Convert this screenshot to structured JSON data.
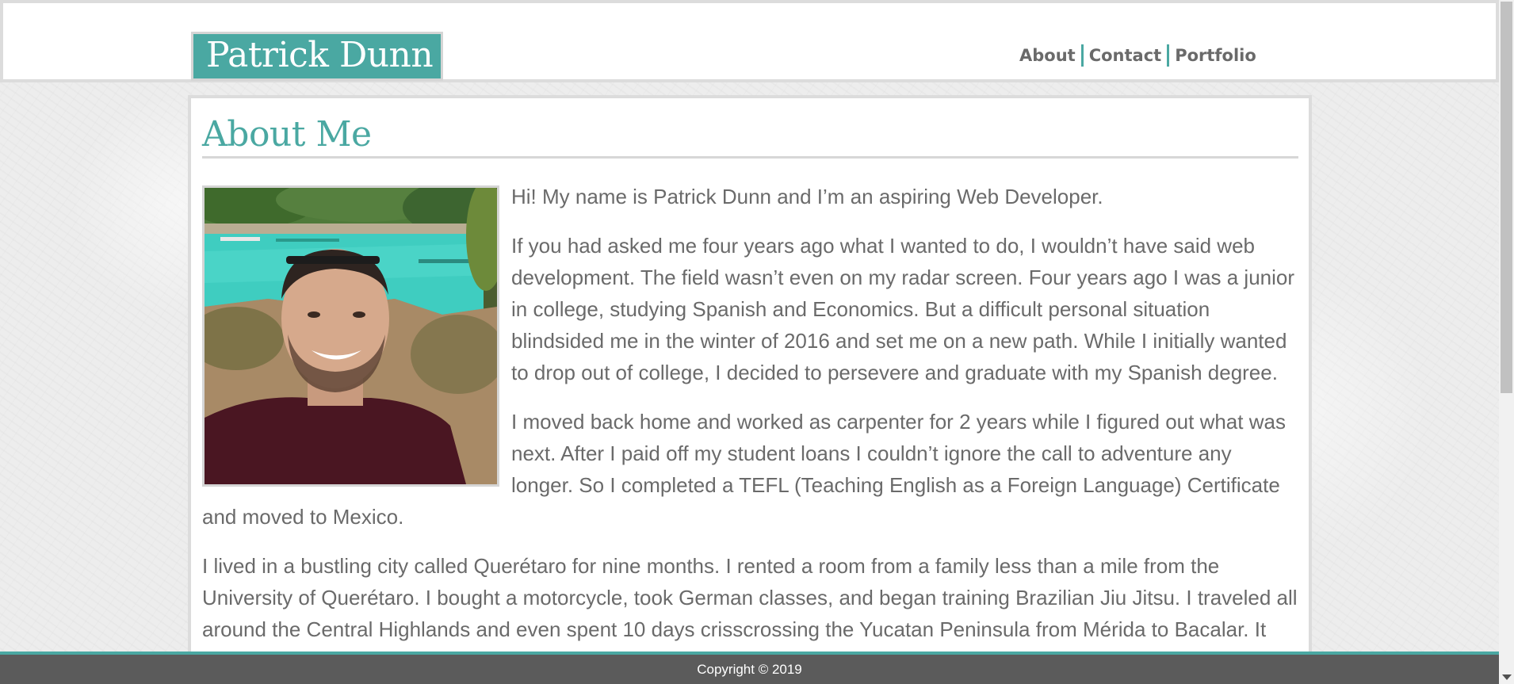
{
  "header": {
    "logo_text": "Patrick Dunn",
    "nav": [
      {
        "label": "About"
      },
      {
        "label": "Contact"
      },
      {
        "label": "Portfolio"
      }
    ]
  },
  "main": {
    "title": "About Me",
    "photo": {
      "alt": "Patrick Dunn selfie in front of turquoise river"
    },
    "paragraphs": [
      "Hi! My name is Patrick Dunn and I’m an aspiring Web Developer.",
      "If you had asked me four years ago what I wanted to do, I wouldn’t have said web development. The field wasn’t even on my radar screen. Four years ago I was a junior in college, studying Spanish and Economics. But a difficult personal situation blindsided me in the winter of 2016 and set me on a new path. While I initially wanted to drop out of college, I decided to persevere and graduate with my Spanish degree.",
      "I moved back home and worked as carpenter for 2 years while I figured out what was next. After I paid off my student loans I couldn’t ignore the call to adventure any longer. So I completed a TEFL (Teaching English as a Foreign Language) Certificate and moved to Mexico.",
      "I lived in a bustling city called Querétaro for nine months. I rented a room from a family less than a mile from the University of Querétaro. I bought a motorcycle, took German classes, and began training Brazilian Jiu Jitsu. I traveled all around the Central Highlands and even spent 10 days crisscrossing the Yucatan Peninsula from Mérida to Bacalar. It was a wonderful time and I will cherish the memories of those nine months for the rest of my life."
    ]
  },
  "footer": {
    "copyright": "Copyright © 2019"
  },
  "colors": {
    "accent": "#4aa8a2",
    "text": "#6a6a6a",
    "footer_bg": "#5b5b5b"
  }
}
